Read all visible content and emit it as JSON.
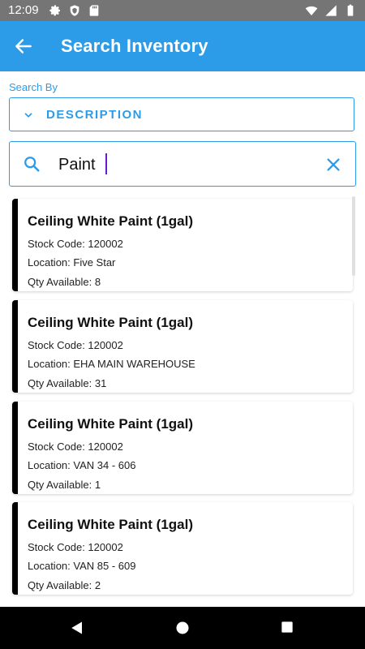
{
  "status_bar": {
    "time": "12:09"
  },
  "app_bar": {
    "title": "Search Inventory"
  },
  "search_by": {
    "label": "Search By",
    "selected": "DESCRIPTION"
  },
  "search": {
    "value": "Paint"
  },
  "results": [
    {
      "title": "Ceiling White Paint (1gal)",
      "stock_code": "Stock Code: 120002",
      "location": "Location: Five Star",
      "qty": "Qty Available: 8"
    },
    {
      "title": "Ceiling White Paint (1gal)",
      "stock_code": "Stock Code: 120002",
      "location": "Location: EHA MAIN WAREHOUSE",
      "qty": "Qty Available: 31"
    },
    {
      "title": "Ceiling White Paint (1gal)",
      "stock_code": "Stock Code: 120002",
      "location": "Location: VAN 34 - 606",
      "qty": "Qty Available: 1"
    },
    {
      "title": "Ceiling White Paint (1gal)",
      "stock_code": "Stock Code: 120002",
      "location": "Location: VAN 85 - 609",
      "qty": "Qty Available: 2"
    }
  ],
  "colors": {
    "accent": "#2D9CE8",
    "status_bar": "#757575",
    "card_border": "#000000"
  },
  "icons": [
    "gear-icon",
    "shield-icon",
    "sd-card-icon",
    "wifi-icon",
    "signal-icon",
    "battery-icon",
    "back-arrow-icon",
    "chevron-down-icon",
    "search-icon",
    "close-icon",
    "nav-back-icon",
    "nav-home-icon",
    "nav-recent-icon"
  ]
}
